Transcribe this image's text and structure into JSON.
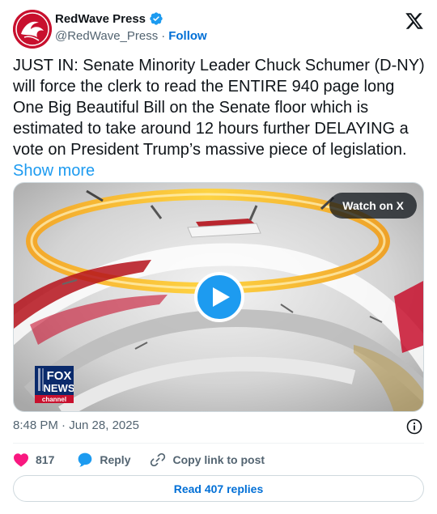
{
  "colors": {
    "accent": "#1d9bf0",
    "link": "#006fd6",
    "like": "#f91880",
    "muted": "#536471",
    "text": "#0f1419"
  },
  "author": {
    "display_name": "RedWave Press",
    "handle": "@RedWave_Press",
    "separator": "·",
    "follow_label": "Follow",
    "verified": true,
    "avatar_icon": "red-wave-logo"
  },
  "tweet": {
    "text": "JUST IN: Senate Minority Leader Chuck Schumer (D-NY) will force the clerk to read the ENTIRE 940 page long One Big Beautiful Bill on the Senate floor which is estimated to take around 12 hours further DELAYING a vote on President Trump’s massive piece of legislation.",
    "show_more_label": "Show more"
  },
  "media": {
    "watch_label": "Watch on X",
    "play_icon": "play-icon",
    "channel_logo": {
      "line1": "FOX",
      "line2": "NEWS",
      "line3": "channel"
    }
  },
  "meta": {
    "timestamp": "8:48 PM · Jun 28, 2025",
    "info_icon": "info-icon"
  },
  "actions": {
    "like_count": "817",
    "reply_label": "Reply",
    "copy_link_label": "Copy link to post"
  },
  "footer": {
    "read_replies_label": "Read 407 replies"
  }
}
